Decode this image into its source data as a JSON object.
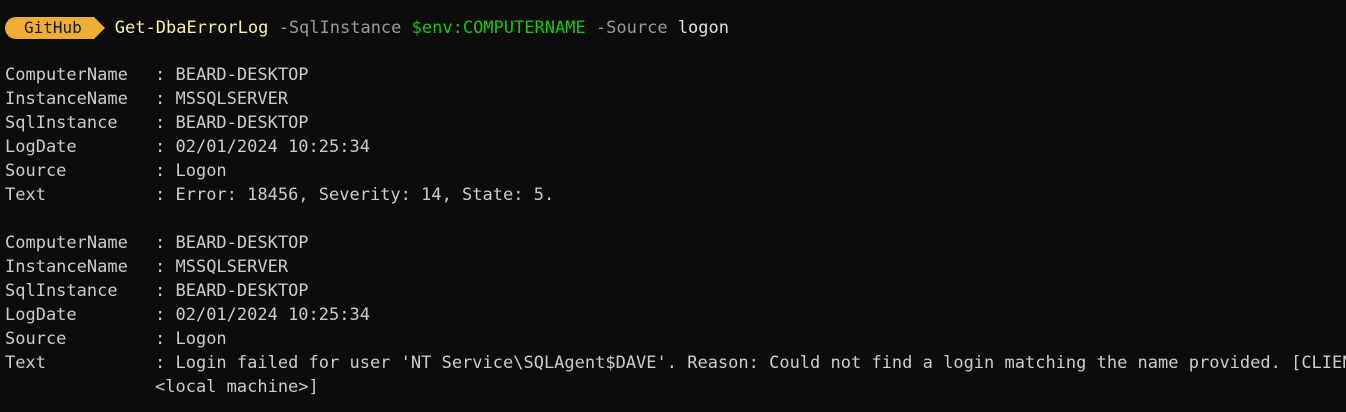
{
  "prompt": {
    "badge": "GitHub",
    "command": "Get-DbaErrorLog",
    "param1": "-SqlInstance",
    "value1": "$env:COMPUTERNAME",
    "param2": "-Source",
    "value2": "logon"
  },
  "separator": ": ",
  "records": [
    {
      "computer_name_label": "ComputerName",
      "computer_name": "BEARD-DESKTOP",
      "instance_name_label": "InstanceName",
      "instance_name": "MSSQLSERVER",
      "sql_instance_label": "SqlInstance",
      "sql_instance": "BEARD-DESKTOP",
      "log_date_label": "LogDate",
      "log_date": "02/01/2024 10:25:34",
      "source_label": "Source",
      "source": "Logon",
      "text_label": "Text",
      "text": "Error: 18456, Severity: 14, State: 5.",
      "text_cont": ""
    },
    {
      "computer_name_label": "ComputerName",
      "computer_name": "BEARD-DESKTOP",
      "instance_name_label": "InstanceName",
      "instance_name": "MSSQLSERVER",
      "sql_instance_label": "SqlInstance",
      "sql_instance": "BEARD-DESKTOP",
      "log_date_label": "LogDate",
      "log_date": "02/01/2024 10:25:34",
      "source_label": "Source",
      "source": "Logon",
      "text_label": "Text",
      "text": "Login failed for user 'NT Service\\SQLAgent$DAVE'. Reason: Could not find a login matching the name provided. [CLIENT:",
      "text_cont": "<local machine>]"
    }
  ]
}
